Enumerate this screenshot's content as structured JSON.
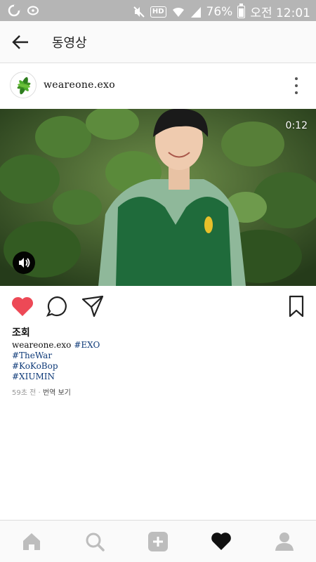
{
  "status_bar": {
    "battery": "76%",
    "time": "오전 12:01",
    "hd_label": "HD",
    "icons": [
      "app-icon",
      "notification-icon",
      "mute-icon",
      "wifi-icon",
      "signal-icon",
      "battery-icon"
    ]
  },
  "header": {
    "title": "동영상",
    "back_icon": "back-arrow-icon"
  },
  "post": {
    "username": "weareone.exo",
    "video_time": "0:12",
    "views_label": "조회",
    "caption_user": "weareone.exo",
    "hashtags": [
      "#EXO",
      "#TheWar",
      "#KoKoBop",
      "#XIUMIN"
    ],
    "time_ago": "59초 전",
    "separator": "·",
    "translate_label": "번역 보기",
    "liked": true
  },
  "colors": {
    "like_red": "#ed4956",
    "hashtag_blue": "#0e3a78",
    "status_bar_bg": "#b5b5b5"
  },
  "bottom_nav": [
    "home-icon",
    "search-icon",
    "add-icon",
    "activity-heart-icon",
    "profile-icon"
  ]
}
